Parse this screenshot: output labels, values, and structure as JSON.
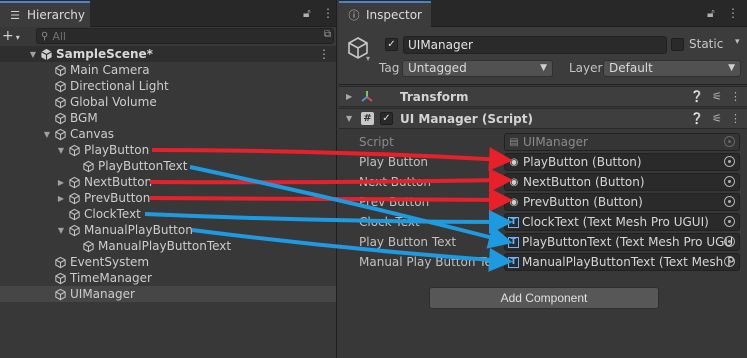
{
  "hierarchy": {
    "tab_label": "Hierarchy",
    "tab_icon": "hierarchy-icon",
    "search_placeholder": "All",
    "plus_label": "+",
    "scene_name": "SampleScene*",
    "items": [
      {
        "label": "Main Camera"
      },
      {
        "label": "Directional Light"
      },
      {
        "label": "Global Volume"
      },
      {
        "label": "BGM"
      },
      {
        "label": "Canvas"
      },
      {
        "label": "PlayButton"
      },
      {
        "label": "PlayButtonText"
      },
      {
        "label": "NextButton"
      },
      {
        "label": "PrevButton"
      },
      {
        "label": "ClockText"
      },
      {
        "label": "ManualPlayButton"
      },
      {
        "label": "ManualPlayButtonText"
      },
      {
        "label": "EventSystem"
      },
      {
        "label": "TimeManager"
      },
      {
        "label": "UIManager"
      }
    ]
  },
  "inspector": {
    "tab_label": "Inspector",
    "tab_icon": "info-icon",
    "object_name": "UIManager",
    "static_label": "Static",
    "tag_label": "Tag",
    "tag_value": "Untagged",
    "layer_label": "Layer",
    "layer_value": "Default",
    "transform_label": "Transform",
    "script_component_label": "UI Manager (Script)",
    "script_label": "Script",
    "script_value": "UIManager",
    "fields": [
      {
        "label": "Play Button",
        "value": "PlayButton (Button)",
        "icon": "button-icon"
      },
      {
        "label": "Next Button",
        "value": "NextButton (Button)",
        "icon": "button-icon"
      },
      {
        "label": "Prev Button",
        "value": "PrevButton (Button)",
        "icon": "button-icon"
      },
      {
        "label": "Clock Text",
        "value": "ClockText (Text Mesh Pro UGUI)",
        "icon": "text-icon"
      },
      {
        "label": "Play Button Text",
        "value": "PlayButtonText (Text Mesh Pro UGU",
        "icon": "text-icon"
      },
      {
        "label": "Manual Play Button Tex",
        "value": "ManualPlayButtonText (Text Mesh P",
        "icon": "text-icon"
      }
    ],
    "add_component_label": "Add Component"
  },
  "annotations": {
    "red_color": "#e8202a",
    "blue_color": "#1e9be0"
  }
}
